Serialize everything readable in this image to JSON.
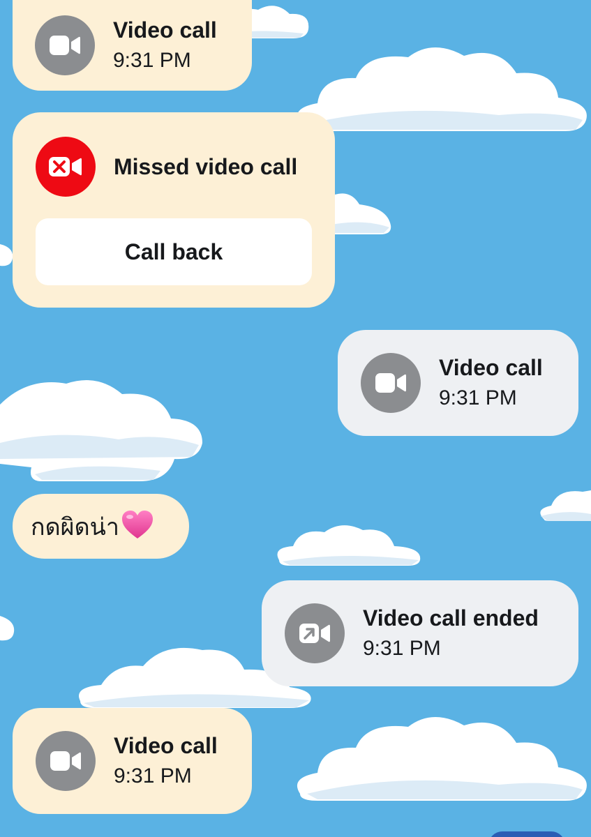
{
  "messages": [
    {
      "kind": "call",
      "direction": "incoming",
      "title": "Video call",
      "time": "9:31 PM",
      "icon": "video-camera-icon"
    },
    {
      "kind": "missed",
      "direction": "incoming",
      "title": "Missed video call",
      "action": "Call back",
      "icon": "missed-video-icon"
    },
    {
      "kind": "call",
      "direction": "outgoing",
      "title": "Video call",
      "time": "9:31 PM",
      "icon": "video-camera-icon"
    },
    {
      "kind": "text",
      "direction": "incoming",
      "text": "กดผิดน่า",
      "emoji": "pink-heart-emoji"
    },
    {
      "kind": "call",
      "direction": "outgoing",
      "title": "Video call ended",
      "time": "9:31 PM",
      "icon": "video-call-ended-icon"
    },
    {
      "kind": "call",
      "direction": "incoming",
      "title": "Video call",
      "time": "9:31 PM",
      "icon": "video-camera-icon"
    }
  ],
  "colors": {
    "background_sky": "#5ab2e4",
    "incoming_bubble": "#fdf0d6",
    "outgoing_bubble": "#eef0f3",
    "icon_grey": "#8b8d90",
    "missed_red": "#ee0a14",
    "heart_pink": "#f04fa6"
  }
}
